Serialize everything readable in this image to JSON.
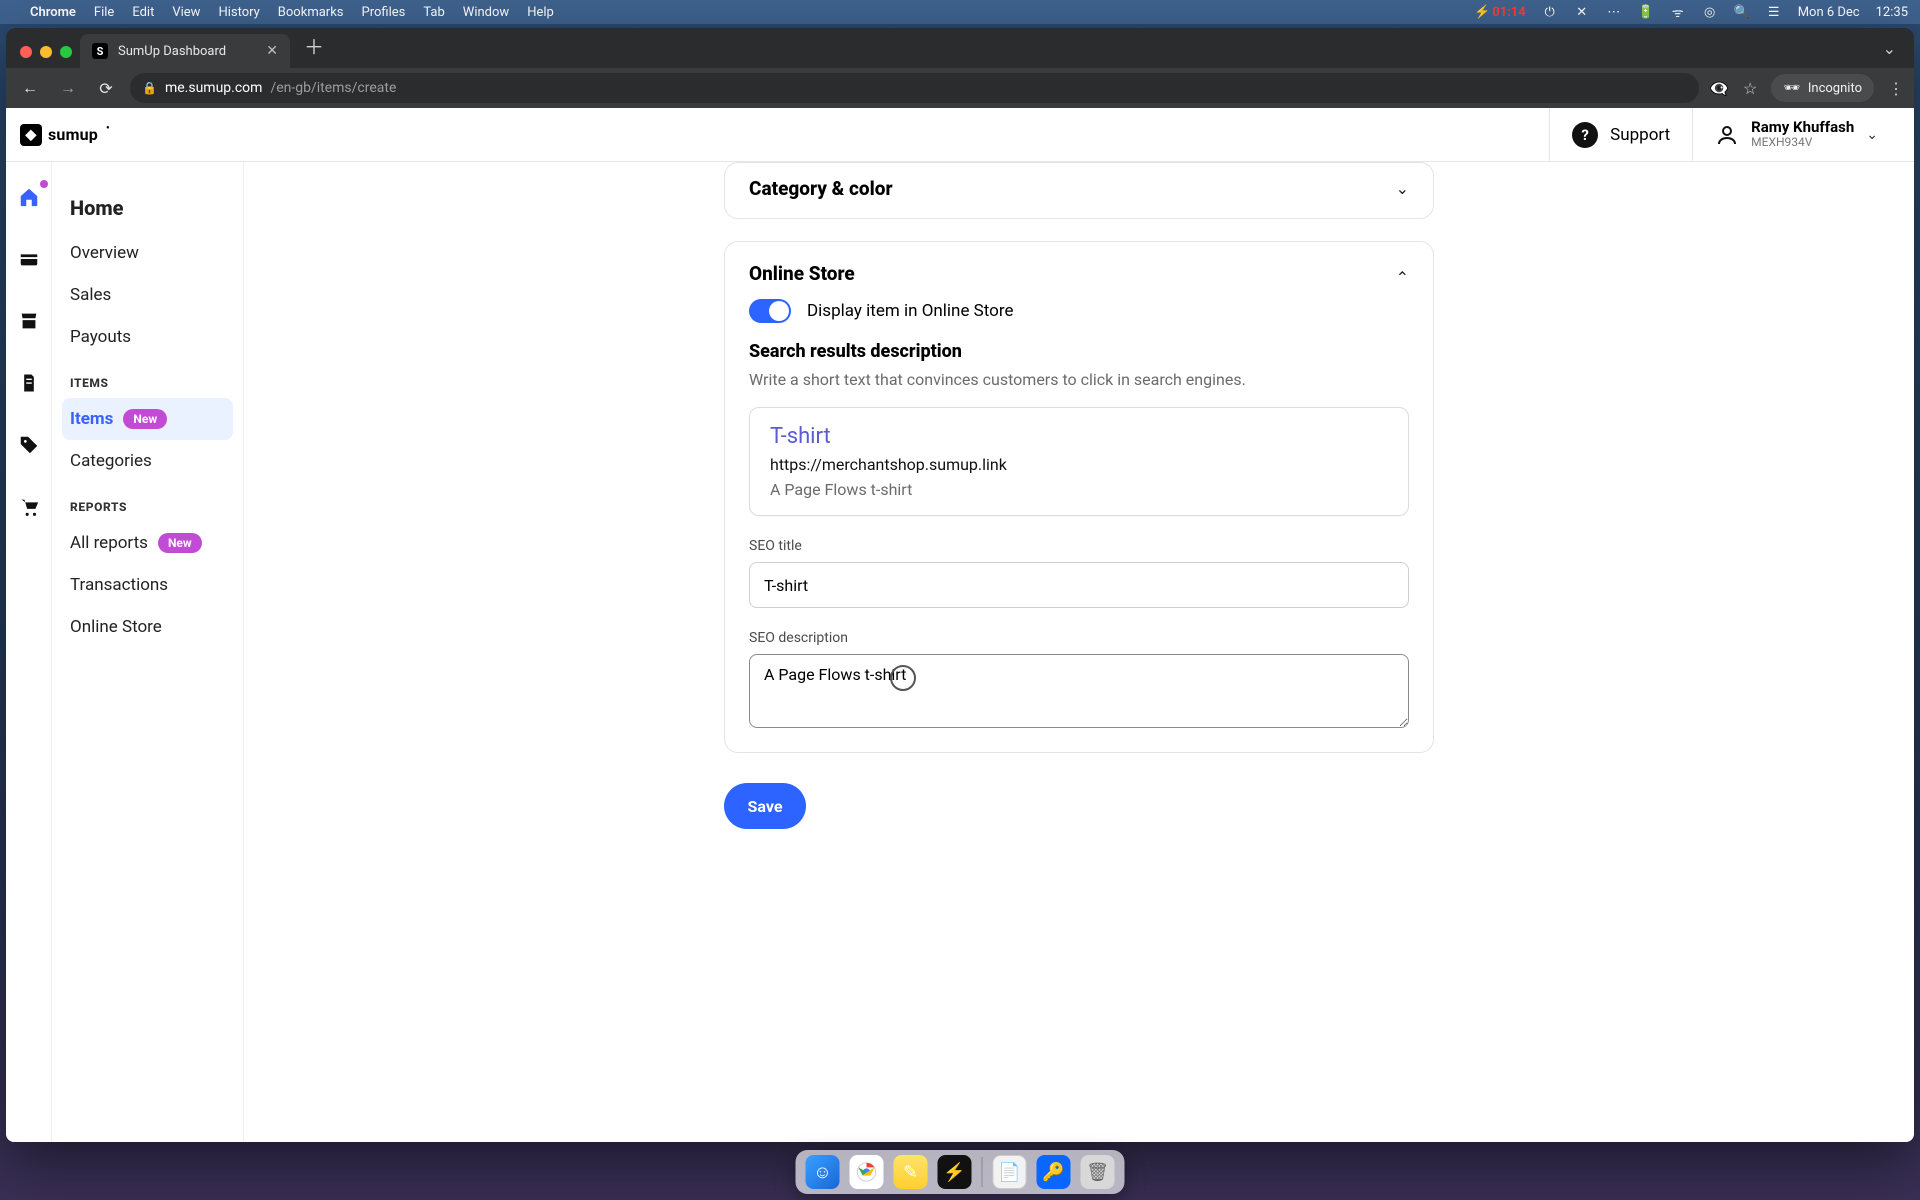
{
  "mac_menu": {
    "items": [
      "Chrome",
      "File",
      "Edit",
      "View",
      "History",
      "Bookmarks",
      "Profiles",
      "Tab",
      "Window",
      "Help"
    ],
    "battery_time": "01:14",
    "wifi": "on",
    "date": "Mon 6 Dec",
    "clock": "12:35"
  },
  "browser": {
    "tab_title": "SumUp Dashboard",
    "url_host": "me.sumup.com",
    "url_path": "/en-gb/items/create",
    "incognito_label": "Incognito"
  },
  "header": {
    "logo_text": "sumup",
    "support_label": "Support",
    "user_name": "Ramy Khuffash",
    "user_code": "MEXH934V"
  },
  "sidebar": {
    "home": "Home",
    "links_top": [
      "Overview",
      "Sales",
      "Payouts"
    ],
    "section_items": "ITEMS",
    "items_link": "Items",
    "items_badge": "New",
    "categories": "Categories",
    "section_reports": "REPORTS",
    "all_reports": "All reports",
    "all_reports_badge": "New",
    "transactions": "Transactions",
    "online_store": "Online Store"
  },
  "form": {
    "category_title": "Category & color",
    "store_title": "Online Store",
    "display_toggle_label": "Display item in Online Store",
    "search_heading": "Search results description",
    "search_hint": "Write a short text that convinces customers to click in search engines.",
    "preview_title": "T-shirt",
    "preview_url": "https://merchantshop.sumup.link",
    "preview_desc": "A Page Flows t-shirt",
    "seo_title_label": "SEO title",
    "seo_title_value": "T-shirt",
    "seo_desc_label": "SEO description",
    "seo_desc_value": "A Page Flows t-shirt",
    "save_label": "Save"
  },
  "dock": {
    "apps": [
      "finder",
      "chrome",
      "notes",
      "iterm",
      "textedit",
      "1password",
      "trash"
    ]
  }
}
